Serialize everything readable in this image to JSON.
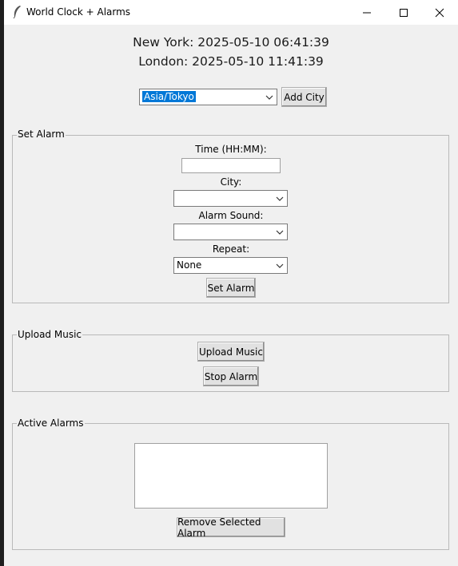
{
  "window": {
    "title": "World Clock + Alarms",
    "controls": [
      "minimize",
      "maximize",
      "close"
    ]
  },
  "clocks": [
    {
      "text": "New York: 2025-05-10 06:41:39"
    },
    {
      "text": "London: 2025-05-10 11:41:39"
    }
  ],
  "city_picker": {
    "selected": "Asia/Tokyo",
    "add_label": "Add City"
  },
  "set_alarm": {
    "legend": "Set Alarm",
    "time_label": "Time (HH:MM):",
    "time_value": "",
    "city_label": "City:",
    "city_value": "",
    "sound_label": "Alarm Sound:",
    "sound_value": "",
    "repeat_label": "Repeat:",
    "repeat_value": "None",
    "submit_label": "Set Alarm"
  },
  "upload_music": {
    "legend": "Upload Music",
    "upload_label": "Upload Music",
    "stop_label": "Stop Alarm"
  },
  "active_alarms": {
    "legend": "Active Alarms",
    "items": [],
    "remove_label": "Remove Selected Alarm"
  },
  "colors": {
    "window_bg": "#f0f0f0",
    "selection": "#0078d7",
    "button_bg": "#e1e1e1"
  }
}
